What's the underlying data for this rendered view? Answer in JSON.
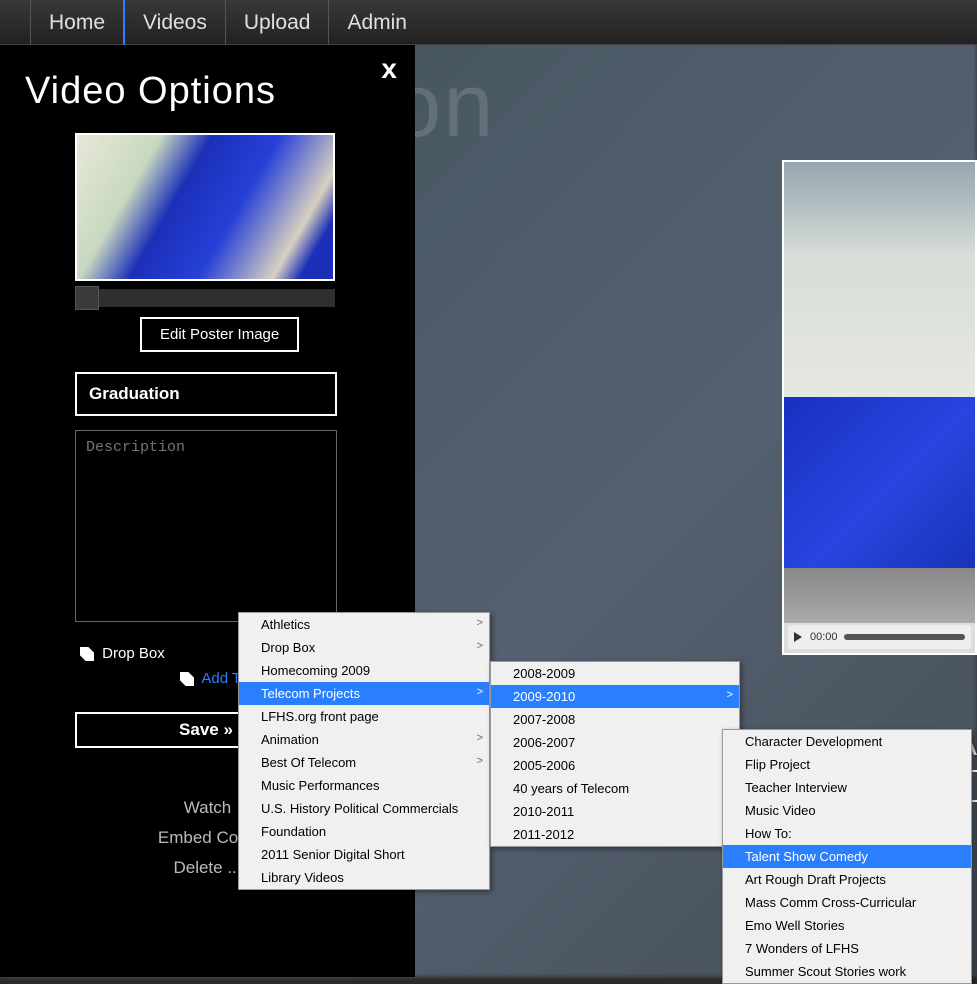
{
  "nav": {
    "items": [
      "Home",
      "Videos",
      "Upload",
      "Admin"
    ],
    "active": "Videos"
  },
  "bg_title": "Graduation",
  "panel": {
    "title": "Video Options",
    "close": "x",
    "edit_poster": "Edit Poster Image",
    "title_value": "Graduation",
    "desc_placeholder": "Description",
    "tags": [
      "Drop Box"
    ],
    "add_tag": "Add Tag",
    "save": "Save »",
    "actions": {
      "watch": "Watch",
      "embed": "Embed Code",
      "delete": "Delete ..."
    }
  },
  "menu1": {
    "items": [
      {
        "label": "Athletics",
        "sub": true
      },
      {
        "label": "Drop Box",
        "sub": true
      },
      {
        "label": "Homecoming 2009"
      },
      {
        "label": "Telecom Projects",
        "sub": true,
        "sel": true
      },
      {
        "label": "LFHS.org front page"
      },
      {
        "label": "Animation",
        "sub": true
      },
      {
        "label": "Best Of Telecom",
        "sub": true
      },
      {
        "label": "Music Performances"
      },
      {
        "label": "U.S. History Political Commercials"
      },
      {
        "label": "Foundation"
      },
      {
        "label": "2011 Senior Digital Short"
      },
      {
        "label": "Library Videos"
      }
    ]
  },
  "menu2": {
    "items": [
      {
        "label": "2008-2009"
      },
      {
        "label": "2009-2010",
        "sub": true,
        "sel": true
      },
      {
        "label": "2007-2008"
      },
      {
        "label": "2006-2007"
      },
      {
        "label": "2005-2006"
      },
      {
        "label": "40 years of Telecom"
      },
      {
        "label": "2010-2011",
        "sub": true
      },
      {
        "label": "2011-2012"
      }
    ]
  },
  "menu3": {
    "items": [
      {
        "label": "Character Development"
      },
      {
        "label": "Flip Project"
      },
      {
        "label": "Teacher Interview"
      },
      {
        "label": "Music Video"
      },
      {
        "label": "How To:"
      },
      {
        "label": "Talent Show Comedy",
        "sel": true
      },
      {
        "label": "Art Rough Draft Projects"
      },
      {
        "label": "Mass Comm Cross-Curricular"
      },
      {
        "label": "Emo Well Stories"
      },
      {
        "label": "7 Wonders of LFHS"
      },
      {
        "label": "Summer Scout Stories work"
      }
    ]
  },
  "player": {
    "time": "00:00"
  },
  "right_name": "McA"
}
